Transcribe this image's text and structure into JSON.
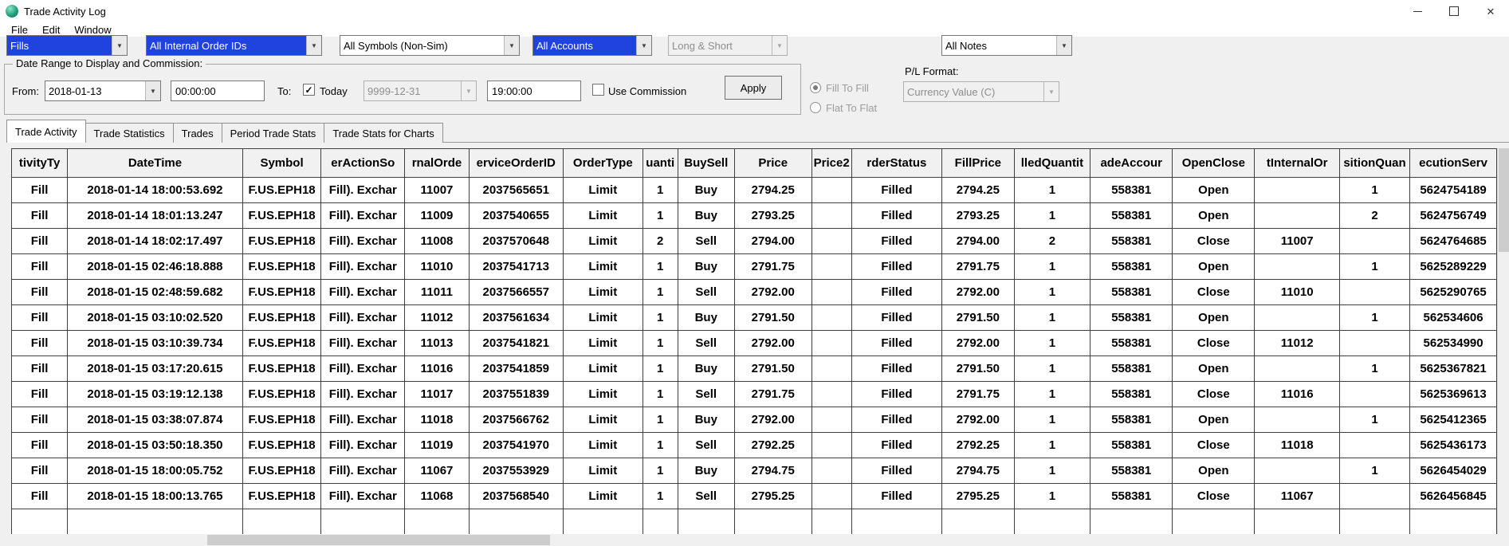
{
  "colors": {
    "selection_bg": "#2043e0",
    "selection_text": "#ffffff"
  },
  "window": {
    "title": "Trade Activity Log",
    "menu": [
      "File",
      "Edit",
      "Window"
    ]
  },
  "filters": {
    "activity_type": "Fills",
    "internal_order_ids": "All Internal Order IDs",
    "symbols": "All Symbols (Non-Sim)",
    "accounts": "All Accounts",
    "long_short": "Long & Short",
    "notes": "All Notes"
  },
  "date_range": {
    "group_label": "Date Range to Display and Commission:",
    "from_label": "From:",
    "from_date": "2018-01-13",
    "from_time": "00:00:00",
    "to_label": "To:",
    "today_label": "Today",
    "today_checked": true,
    "to_date": "9999-12-31",
    "to_time": "19:00:00",
    "use_commission_label": "Use Commission",
    "use_commission_checked": false,
    "apply_label": "Apply"
  },
  "radio": {
    "fill_to_fill": "Fill To Fill",
    "flat_to_flat": "Flat To Flat",
    "selected": "Fill To Fill"
  },
  "pl": {
    "label": "P/L Format:",
    "value": "Currency Value (C)"
  },
  "tabs": [
    {
      "label": "Trade Activity",
      "active": true
    },
    {
      "label": "Trade Statistics",
      "active": false
    },
    {
      "label": "Trades",
      "active": false
    },
    {
      "label": "Period Trade Stats",
      "active": false
    },
    {
      "label": "Trade Stats for Charts",
      "active": false
    }
  ],
  "table": {
    "columns": [
      "tivityTy",
      "DateTime",
      "Symbol",
      "erActionSo",
      "rnalOrde",
      "erviceOrderID",
      "OrderType",
      "uanti",
      "BuySell",
      "Price",
      "Price2",
      "rderStatus",
      "FillPrice",
      "lledQuantit",
      "adeAccour",
      "OpenClose",
      "tInternalOr",
      "sitionQuan",
      "ecutionServ"
    ],
    "rows": [
      [
        "Fill",
        "2018-01-14 18:00:53.692",
        "F.US.EPH18",
        "Fill). Exchar",
        "11007",
        "2037565651",
        "Limit",
        "1",
        "Buy",
        "2794.25",
        "",
        "Filled",
        "2794.25",
        "1",
        "558381",
        "Open",
        "",
        "1",
        "5624754189"
      ],
      [
        "Fill",
        "2018-01-14 18:01:13.247",
        "F.US.EPH18",
        "Fill). Exchar",
        "11009",
        "2037540655",
        "Limit",
        "1",
        "Buy",
        "2793.25",
        "",
        "Filled",
        "2793.25",
        "1",
        "558381",
        "Open",
        "",
        "2",
        "5624756749"
      ],
      [
        "Fill",
        "2018-01-14 18:02:17.497",
        "F.US.EPH18",
        "Fill). Exchar",
        "11008",
        "2037570648",
        "Limit",
        "2",
        "Sell",
        "2794.00",
        "",
        "Filled",
        "2794.00",
        "2",
        "558381",
        "Close",
        "11007",
        "",
        "5624764685"
      ],
      [
        "Fill",
        "2018-01-15 02:46:18.888",
        "F.US.EPH18",
        "Fill). Exchar",
        "11010",
        "2037541713",
        "Limit",
        "1",
        "Buy",
        "2791.75",
        "",
        "Filled",
        "2791.75",
        "1",
        "558381",
        "Open",
        "",
        "1",
        "5625289229"
      ],
      [
        "Fill",
        "2018-01-15 02:48:59.682",
        "F.US.EPH18",
        "Fill). Exchar",
        "11011",
        "2037566557",
        "Limit",
        "1",
        "Sell",
        "2792.00",
        "",
        "Filled",
        "2792.00",
        "1",
        "558381",
        "Close",
        "11010",
        "",
        "5625290765"
      ],
      [
        "Fill",
        "2018-01-15 03:10:02.520",
        "F.US.EPH18",
        "Fill). Exchar",
        "11012",
        "2037561634",
        "Limit",
        "1",
        "Buy",
        "2791.50",
        "",
        "Filled",
        "2791.50",
        "1",
        "558381",
        "Open",
        "",
        "1",
        "562534606"
      ],
      [
        "Fill",
        "2018-01-15 03:10:39.734",
        "F.US.EPH18",
        "Fill). Exchar",
        "11013",
        "2037541821",
        "Limit",
        "1",
        "Sell",
        "2792.00",
        "",
        "Filled",
        "2792.00",
        "1",
        "558381",
        "Close",
        "11012",
        "",
        "562534990"
      ],
      [
        "Fill",
        "2018-01-15 03:17:20.615",
        "F.US.EPH18",
        "Fill). Exchar",
        "11016",
        "2037541859",
        "Limit",
        "1",
        "Buy",
        "2791.50",
        "",
        "Filled",
        "2791.50",
        "1",
        "558381",
        "Open",
        "",
        "1",
        "5625367821"
      ],
      [
        "Fill",
        "2018-01-15 03:19:12.138",
        "F.US.EPH18",
        "Fill). Exchar",
        "11017",
        "2037551839",
        "Limit",
        "1",
        "Sell",
        "2791.75",
        "",
        "Filled",
        "2791.75",
        "1",
        "558381",
        "Close",
        "11016",
        "",
        "5625369613"
      ],
      [
        "Fill",
        "2018-01-15 03:38:07.874",
        "F.US.EPH18",
        "Fill). Exchar",
        "11018",
        "2037566762",
        "Limit",
        "1",
        "Buy",
        "2792.00",
        "",
        "Filled",
        "2792.00",
        "1",
        "558381",
        "Open",
        "",
        "1",
        "5625412365"
      ],
      [
        "Fill",
        "2018-01-15 03:50:18.350",
        "F.US.EPH18",
        "Fill). Exchar",
        "11019",
        "2037541970",
        "Limit",
        "1",
        "Sell",
        "2792.25",
        "",
        "Filled",
        "2792.25",
        "1",
        "558381",
        "Close",
        "11018",
        "",
        "5625436173"
      ],
      [
        "Fill",
        "2018-01-15 18:00:05.752",
        "F.US.EPH18",
        "Fill). Exchar",
        "11067",
        "2037553929",
        "Limit",
        "1",
        "Buy",
        "2794.75",
        "",
        "Filled",
        "2794.75",
        "1",
        "558381",
        "Open",
        "",
        "1",
        "5626454029"
      ],
      [
        "Fill",
        "2018-01-15 18:00:13.765",
        "F.US.EPH18",
        "Fill). Exchar",
        "11068",
        "2037568540",
        "Limit",
        "1",
        "Sell",
        "2795.25",
        "",
        "Filled",
        "2795.25",
        "1",
        "558381",
        "Close",
        "11067",
        "",
        "5626456845"
      ]
    ]
  }
}
